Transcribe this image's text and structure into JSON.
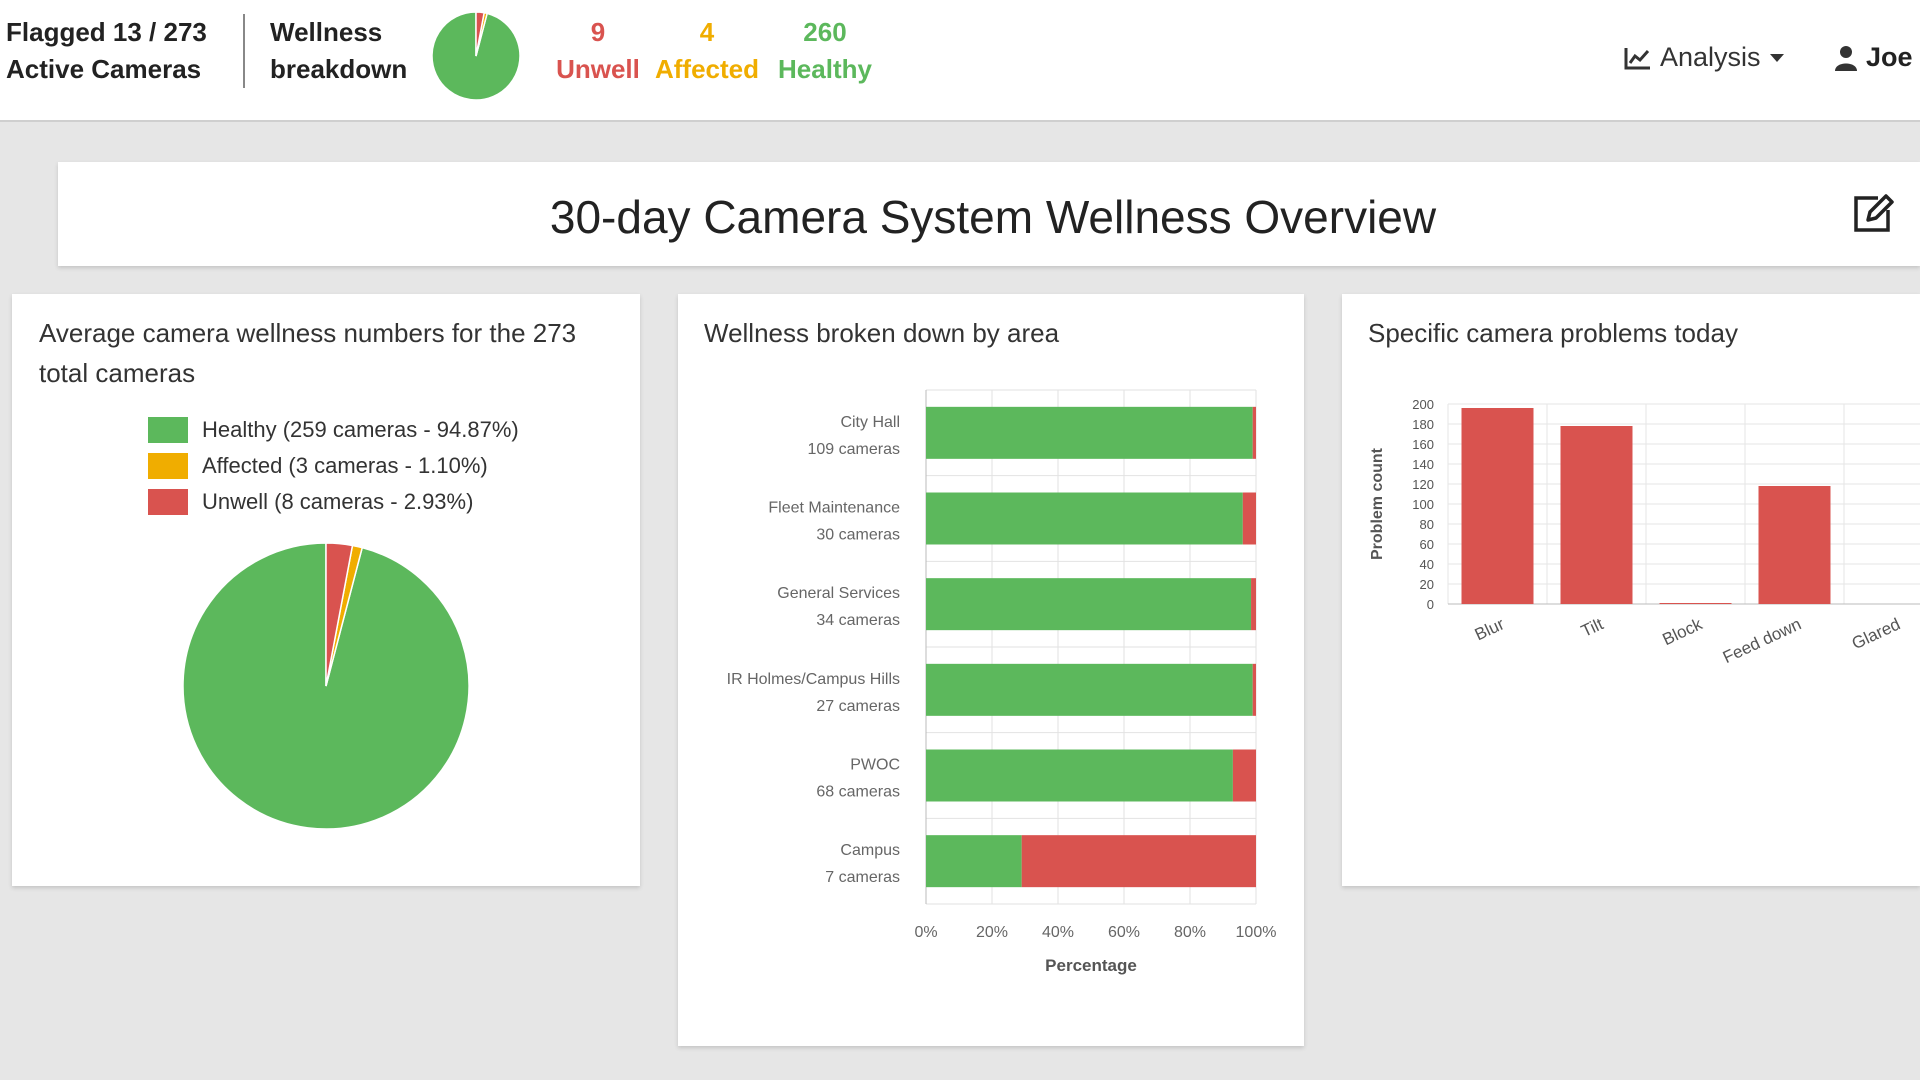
{
  "header": {
    "flagged_line1": "Flagged 13 / 273",
    "flagged_line2": "Active Cameras",
    "breakdown_line1": "Wellness",
    "breakdown_line2": "breakdown",
    "unwell_count": "9",
    "unwell_label": "Unwell",
    "affected_count": "4",
    "affected_label": "Affected",
    "healthy_count": "260",
    "healthy_label": "Healthy",
    "analysis_label": "Analysis",
    "user_label": "Joe"
  },
  "page_title": "30-day Camera System Wellness Overview",
  "colors": {
    "healthy": "#5cb85c",
    "affected": "#f0ad00",
    "unwell": "#d9534f"
  },
  "icons": [
    "line-chart-icon",
    "caret-down-icon",
    "user-icon",
    "edit-icon"
  ],
  "panels": {
    "average": {
      "title": "Average camera wellness numbers for the 273 total cameras",
      "legend": [
        {
          "label": "Healthy (259 cameras - 94.87%)",
          "color": "#5cb85c"
        },
        {
          "label": "Affected (3 cameras - 1.10%)",
          "color": "#f0ad00"
        },
        {
          "label": "Unwell (8 cameras - 2.93%)",
          "color": "#d9534f"
        }
      ]
    },
    "area": {
      "title": "Wellness broken down by area"
    },
    "problems": {
      "title": "Specific camera problems today"
    }
  },
  "chart_data": [
    {
      "type": "pie",
      "labels": [
        "Healthy",
        "Affected",
        "Unwell"
      ],
      "values": [
        259,
        3,
        8
      ],
      "colors": [
        "#5cb85c",
        "#f0ad00",
        "#d9534f"
      ]
    },
    {
      "type": "bar",
      "orientation": "horizontal",
      "stacked": true,
      "categories": [
        [
          "City Hall",
          "109 cameras"
        ],
        [
          "Fleet Maintenance",
          "30 cameras"
        ],
        [
          "General Services",
          "34 cameras"
        ],
        [
          "IR Holmes/Campus Hills",
          "27 cameras"
        ],
        [
          "PWOC",
          "68 cameras"
        ],
        [
          "Campus",
          "7 cameras"
        ]
      ],
      "series": [
        {
          "name": "Healthy",
          "color": "#5cb85c",
          "values": [
            99,
            96,
            98.5,
            99,
            93,
            29
          ]
        },
        {
          "name": "Unwell",
          "color": "#d9534f",
          "values": [
            1,
            4,
            1.5,
            1,
            7,
            71
          ]
        }
      ],
      "xlabel": "Percentage",
      "xticks": [
        "0%",
        "20%",
        "40%",
        "60%",
        "80%",
        "100%"
      ],
      "xlim": [
        0,
        100
      ],
      "grid": true
    },
    {
      "type": "bar",
      "categories": [
        "Blur",
        "Tilt",
        "Block",
        "Feed down",
        "Glared"
      ],
      "values": [
        196,
        178,
        1,
        118,
        0
      ],
      "color": "#d9534f",
      "ylabel": "Problem count",
      "ylim": [
        0,
        200
      ],
      "yticks": [
        0,
        20,
        40,
        60,
        80,
        100,
        120,
        140,
        160,
        180,
        200
      ],
      "grid": true
    }
  ]
}
